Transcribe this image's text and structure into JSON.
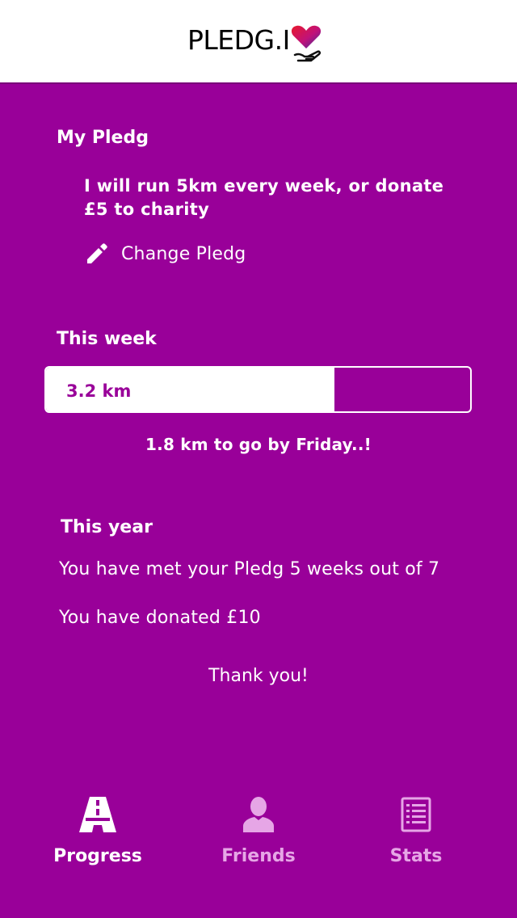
{
  "header": {
    "logo_text": "PLEDG.I"
  },
  "my_pledg": {
    "title": "My Pledg",
    "pledge_text": "I will run 5km every week, or donate £5 to charity",
    "change_label": "Change Pledg"
  },
  "this_week": {
    "title": "This week",
    "progress_label": "3.2 km",
    "progress_fraction": 0.68,
    "remaining_text": "1.8 km to go by Friday..!"
  },
  "this_year": {
    "title": "This year",
    "met_text": "You have met your Pledg 5 weeks out of 7",
    "donated_text": "You have donated £10",
    "thanks_text": "Thank you!"
  },
  "tabs": [
    {
      "label": "Progress",
      "icon": "road-icon",
      "active": true
    },
    {
      "label": "Friends",
      "icon": "person-icon",
      "active": false
    },
    {
      "label": "Stats",
      "icon": "list-icon",
      "active": false
    }
  ],
  "colors": {
    "background": "#990099",
    "header_bg": "#ffffff",
    "inactive_tab": "#e6a6e6",
    "logo_heart_red": "#e8192c",
    "logo_heart_blue": "#3a2a9a"
  }
}
